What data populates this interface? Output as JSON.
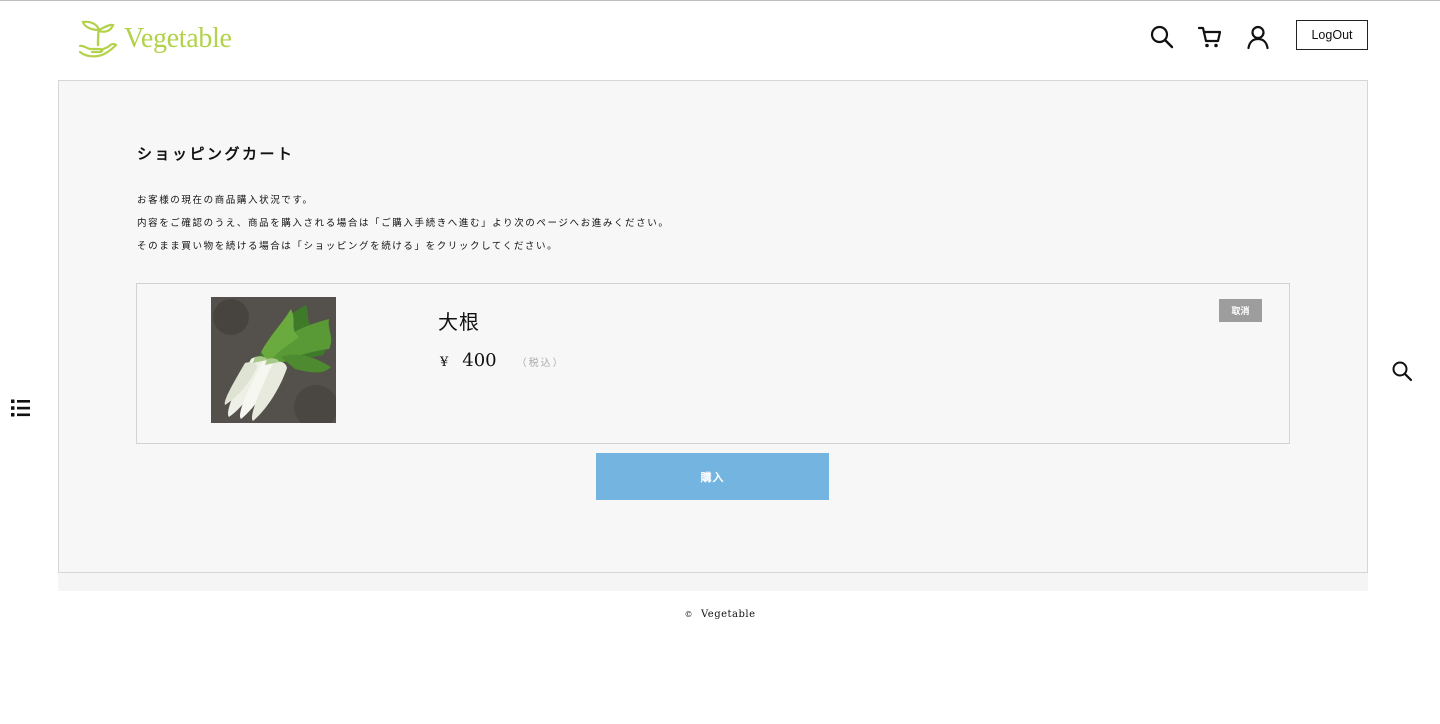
{
  "header": {
    "logo_text": "Vegetable",
    "logout_label": "LogOut",
    "icons": [
      "search-icon",
      "cart-icon",
      "user-icon"
    ]
  },
  "side": {
    "left_icon": "list-icon",
    "right_icon": "search-icon"
  },
  "cart": {
    "title": "ショッピングカート",
    "description": [
      "お客様の現在の商品購入状況です。",
      "内容をご確認のうえ、商品を購入される場合は「ご購入手続きへ進む」より次のページへお進みください。",
      "そのまま買い物を続ける場合は「ショッピングを続ける」をクリックしてください。"
    ],
    "items": [
      {
        "name": "大根",
        "currency": "¥",
        "price": "400",
        "tax_note": "（税込）",
        "cancel_label": "取消",
        "image": "daikon-photo"
      }
    ],
    "buy_label": "購入"
  },
  "footer": {
    "symbol": "©",
    "text": "Vegetable"
  },
  "colors": {
    "logo_green": "#b3d24a",
    "buy_button": "#73b5e0",
    "cancel_button": "#9d9d9d",
    "panel_background": "#f7f7f7"
  }
}
